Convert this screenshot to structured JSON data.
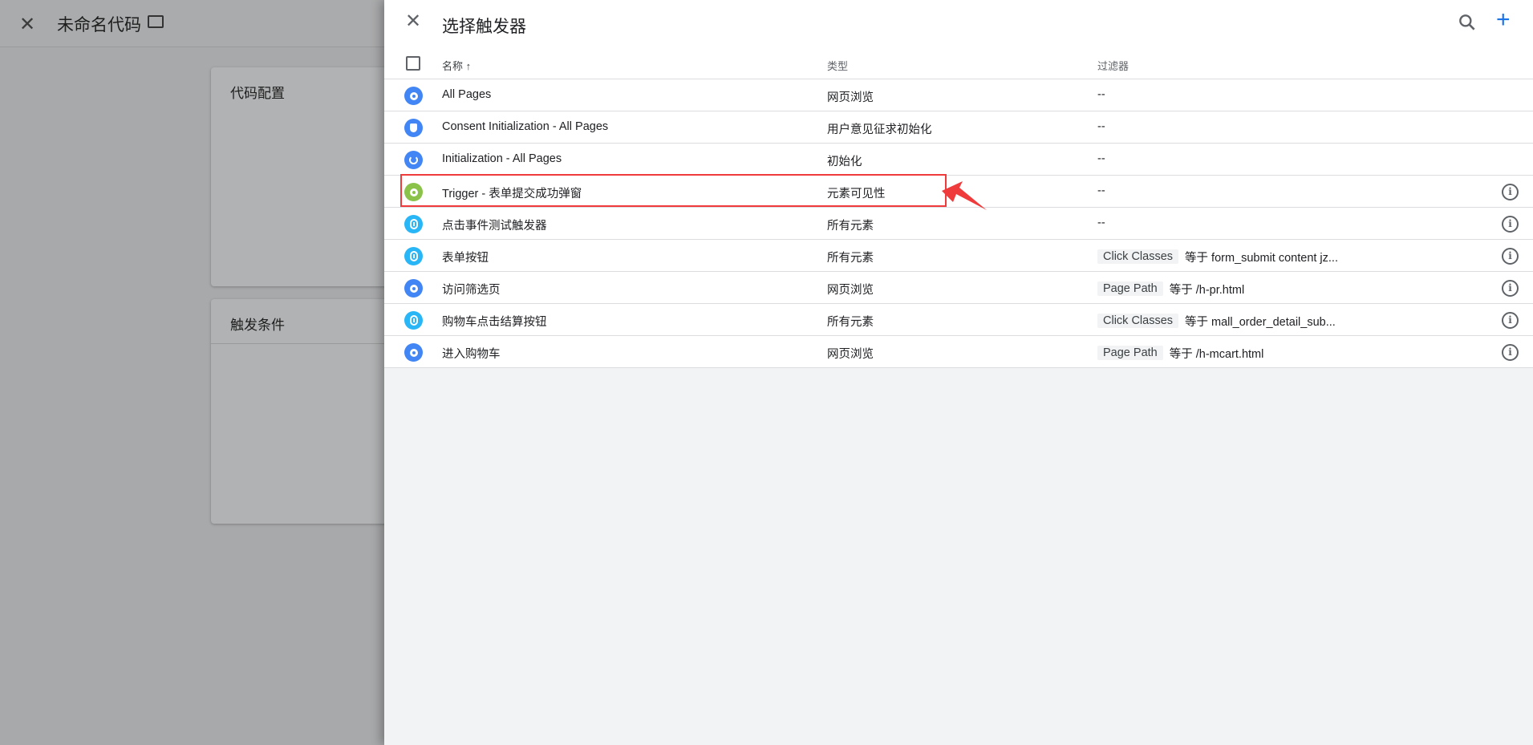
{
  "background": {
    "title": "未命名代码",
    "card_config": "代码配置",
    "card_trigger": "触发条件"
  },
  "panel": {
    "title": "选择触发器",
    "columns": {
      "name": "名称 ↑",
      "type": "类型",
      "filter": "过滤器"
    },
    "rows": [
      {
        "name": "All Pages",
        "type": "网页浏览",
        "filter_text": "--",
        "icon": "eye-icon",
        "color": "#4285f4",
        "info": false
      },
      {
        "name": "Consent Initialization - All Pages",
        "type": "用户意见征求初始化",
        "filter_text": "--",
        "icon": "shield-icon",
        "color": "#4285f4",
        "info": false
      },
      {
        "name": "Initialization - All Pages",
        "type": "初始化",
        "filter_text": "--",
        "icon": "power-icon",
        "color": "#4285f4",
        "info": false
      },
      {
        "name": "Trigger - 表单提交成功弹窗",
        "type": "元素可见性",
        "filter_text": "--",
        "icon": "eye-icon",
        "color": "#8bc34a",
        "info": true,
        "highlighted": true
      },
      {
        "name": "点击事件测试触发器",
        "type": "所有元素",
        "filter_text": "--",
        "icon": "mouse-icon",
        "color": "#29b6f6",
        "info": true
      },
      {
        "name": "表单按钮",
        "type": "所有元素",
        "filter_tag": "Click Classes",
        "filter_text": "等于 form_submit content jz...",
        "icon": "mouse-icon",
        "color": "#29b6f6",
        "info": true
      },
      {
        "name": "访问筛选页",
        "type": "网页浏览",
        "filter_tag": "Page Path",
        "filter_text": "等于 /h-pr.html",
        "icon": "eye-icon",
        "color": "#4285f4",
        "info": true
      },
      {
        "name": "购物车点击结算按钮",
        "type": "所有元素",
        "filter_tag": "Click Classes",
        "filter_text": "等于 mall_order_detail_sub...",
        "icon": "mouse-icon",
        "color": "#29b6f6",
        "info": true
      },
      {
        "name": "进入购物车",
        "type": "网页浏览",
        "filter_tag": "Page Path",
        "filter_text": "等于 /h-mcart.html",
        "icon": "eye-icon",
        "color": "#4285f4",
        "info": true
      }
    ]
  },
  "annotation_color": "#ef3b3b"
}
